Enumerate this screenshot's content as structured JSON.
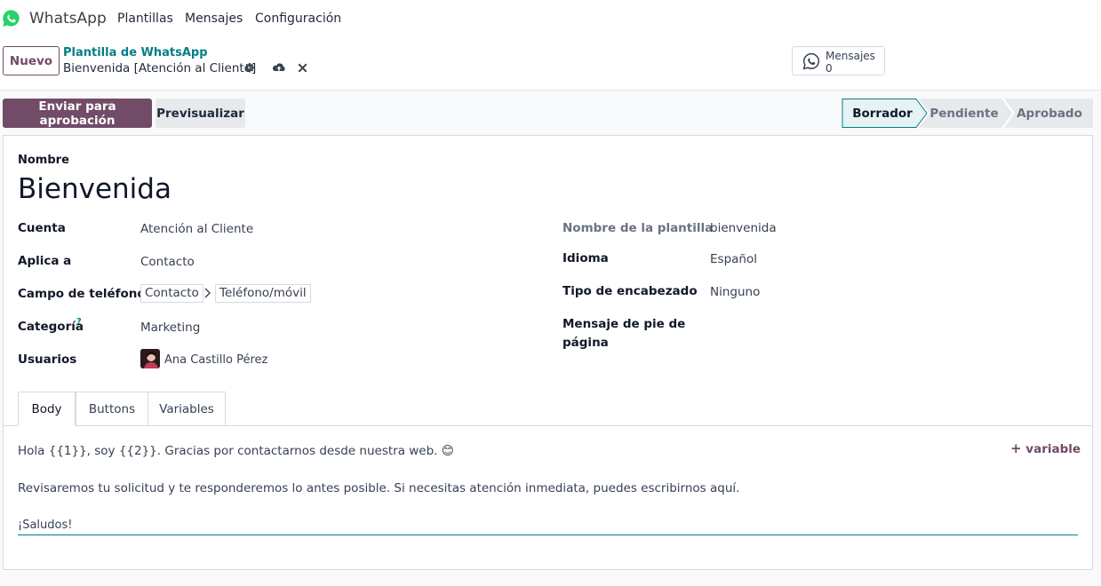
{
  "nav": {
    "app_name": "WhatsApp",
    "menu": [
      "Plantillas",
      "Mensajes",
      "Configuración"
    ],
    "brand_color": "#25D366"
  },
  "control_panel": {
    "new_button": "Nuevo",
    "breadcrumb_parent": "Plantilla de WhatsApp",
    "breadcrumb_current": "Bienvenida [Atención al Cliente]",
    "icons": [
      "gear-icon",
      "cloud-upload-icon",
      "close-icon"
    ],
    "messages_button": {
      "label": "Mensajes",
      "count": "0",
      "icon": "whatsapp-icon"
    }
  },
  "actions": {
    "send_approval": "Enviar para aprobación",
    "preview": "Previsualizar"
  },
  "status": {
    "stages": [
      "Borrador",
      "Pendiente",
      "Aprobado"
    ],
    "active": "Borrador",
    "accent_color": "#017e84"
  },
  "form": {
    "name_label": "Nombre",
    "name_value": "Bienvenida",
    "left": {
      "account_label": "Cuenta",
      "account_value": "Atención al Cliente",
      "applies_label": "Aplica a",
      "applies_value": "Contacto",
      "phone_label": "Campo de teléfono",
      "phone_path": [
        "Contacto",
        "Teléfono/móvil"
      ],
      "category_label": "Categoría",
      "category_help": "?",
      "category_value": "Marketing",
      "users_label": "Usuarios",
      "users_value": "Ana Castillo Pérez"
    },
    "right": {
      "template_name_label": "Nombre de la plantilla",
      "template_name_value": "bienvenida",
      "language_label": "Idioma",
      "language_value": "Español",
      "header_type_label": "Tipo de encabezado",
      "header_type_value": "Ninguno",
      "footer_label_1": "Mensaje de pie de",
      "footer_label_2": "página"
    }
  },
  "tabs": [
    "Body",
    "Buttons",
    "Variables"
  ],
  "body": {
    "line1": "Hola {{1}}, soy {{2}}. Gracias por contactarnos desde nuestra web. 😊",
    "line2": "Revisaremos tu solicitud y te responderemos lo antes posible. Si necesitas atención inmediata, puedes escribirnos aquí.",
    "line3": "¡Saludos!",
    "add_variable": "variable"
  }
}
